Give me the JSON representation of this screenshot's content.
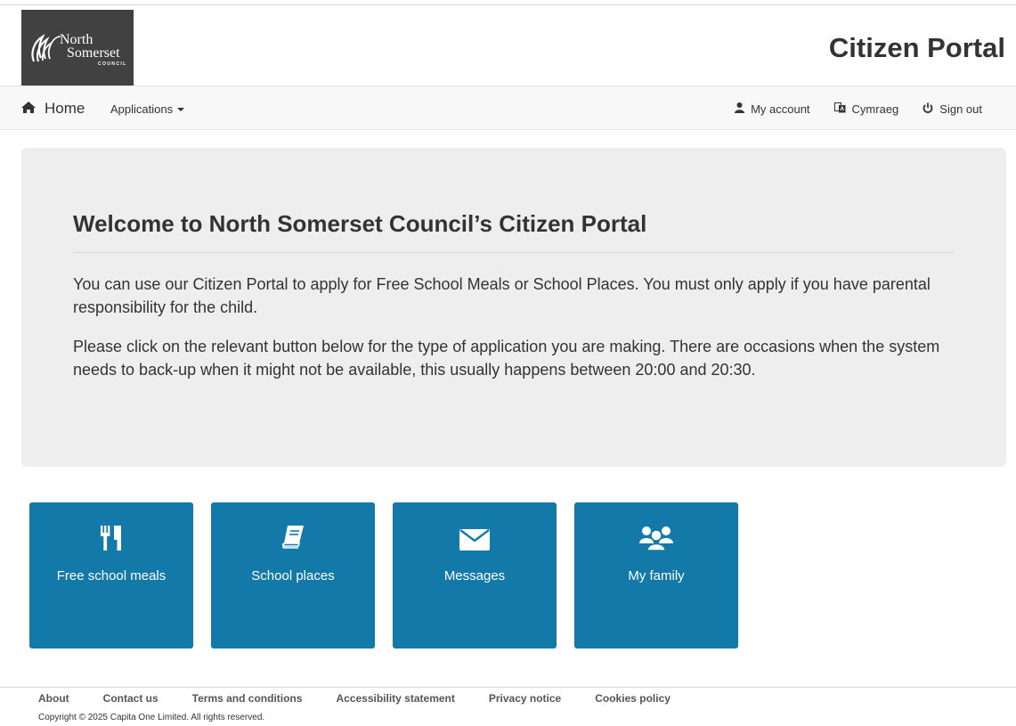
{
  "header": {
    "logo": {
      "line1": "North",
      "line2": "Somerset",
      "line3": "COUNCIL"
    },
    "title": "Citizen Portal"
  },
  "nav": {
    "home_label": "Home",
    "applications_label": "Applications",
    "my_account_label": "My account",
    "language_label": "Cymraeg",
    "sign_out_label": "Sign out"
  },
  "welcome": {
    "heading": "Welcome to North Somerset Council’s Citizen Portal",
    "paragraph1": "You can use our Citizen Portal to apply for Free School Meals or School Places. You must only apply if you have parental responsibility for the child.",
    "paragraph2": "Please click on the relevant button below for the type of application you are making. There are occasions when the system needs to back-up when it might not be available, this usually happens between 20:00 and 20:30."
  },
  "tiles": [
    {
      "label": "Free school meals",
      "icon": "cutlery-icon"
    },
    {
      "label": "School places",
      "icon": "book-icon"
    },
    {
      "label": "Messages",
      "icon": "envelope-icon"
    },
    {
      "label": "My family",
      "icon": "users-icon"
    }
  ],
  "footer": {
    "links": [
      "About",
      "Contact us",
      "Terms and conditions",
      "Accessibility statement",
      "Privacy notice",
      "Cookies policy"
    ],
    "copyright": "Copyright © 2025 Capita One Limited. All rights reserved."
  },
  "colors": {
    "tile": "#1379a8",
    "logo_bg": "#414142",
    "jumbotron_bg": "#eeeeee"
  }
}
